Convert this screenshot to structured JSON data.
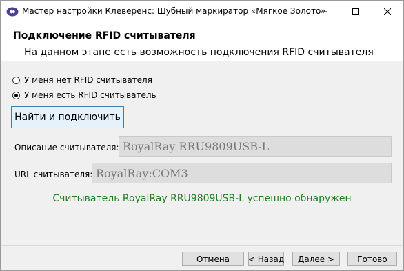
{
  "window": {
    "title": "Мастер настройки Клеверенс: Шубный маркиратор «Мягкое Золото»",
    "controls": [
      "minimize-icon",
      "maximize-icon",
      "close-icon"
    ]
  },
  "header": {
    "title": "Подключение RFID считывателя",
    "subtitle": "На данном этапе есть возможность подключения RFID считывателя"
  },
  "options": {
    "no_reader": {
      "label": "У меня нет RFID считывателя",
      "checked": false
    },
    "has_reader": {
      "label": "У меня есть RFID считыватель",
      "checked": true
    }
  },
  "find_button_label": "Найти и подключить",
  "fields": {
    "description": {
      "label": "Описание считывателя:",
      "value": "RoyalRay RRU9809USB-L"
    },
    "url": {
      "label": "URL считывателя:",
      "value": "RoyalRay:COM3"
    }
  },
  "status_text": "Считыватель RoyalRay RRU9809USB-L успешно обнаружен",
  "colors": {
    "status": "#1e7e1e",
    "accent": "#3c7fb1"
  },
  "footer": {
    "cancel": "Отмена",
    "back": "< Назад",
    "next": "Далее >",
    "finish": "Готово"
  }
}
